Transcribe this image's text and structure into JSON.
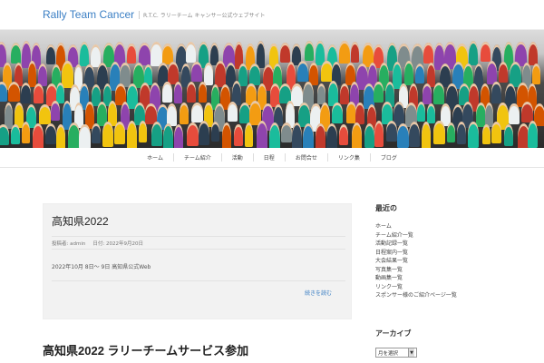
{
  "site": {
    "title": "Rally Team Cancer",
    "tagline": "R.T.C. ラリーチーム キャンサー公式ウェブサイト"
  },
  "nav": {
    "items": [
      "ホーム",
      "チーム紹介",
      "活動",
      "日程",
      "お問合せ",
      "リンク集",
      "ブログ"
    ]
  },
  "post": {
    "title": "高知県2022",
    "meta_author": "投稿者: admin",
    "meta_date": "日付: 2022年9月20日",
    "excerpt": "2022年10月 8日〜 9日 高知県公式Web",
    "more_link": "続きを読む"
  },
  "post2": {
    "title": "高知県2022 ラリーチームサービス参加"
  },
  "sidebar": {
    "widget1_title": "最近の",
    "widget1_items": [
      "ホーム",
      "チーム紹介一覧",
      "活動記録一覧",
      "日程案内一覧",
      "大会結果一覧",
      "写真集一覧",
      "動画集一覧",
      "リンク一覧",
      "スポンサー様のご紹介ページ一覧"
    ],
    "widget2_title": "アーカイブ",
    "select_value": "月を選択"
  }
}
